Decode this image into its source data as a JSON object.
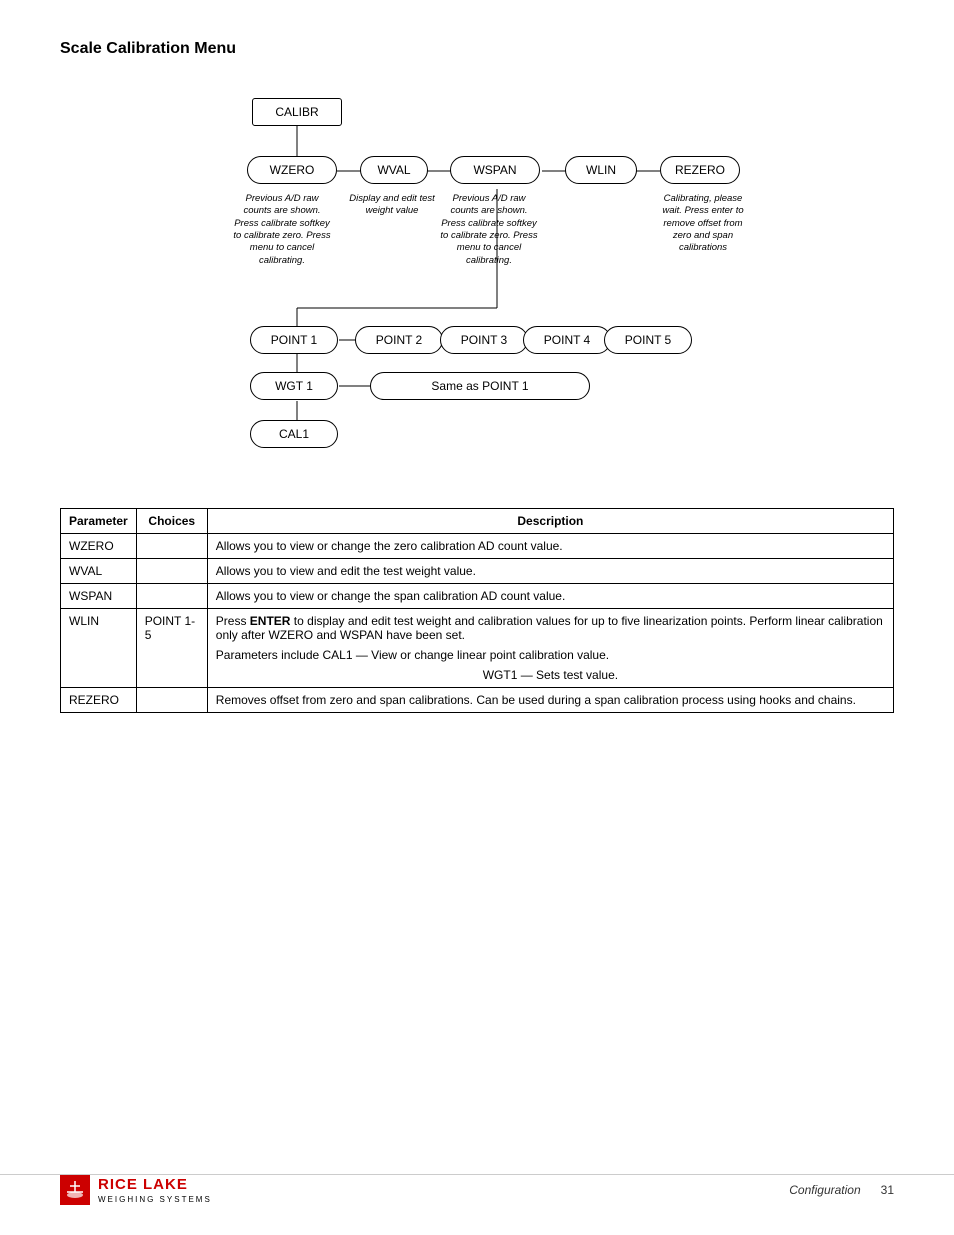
{
  "page": {
    "title": "Scale Calibration Menu"
  },
  "diagram": {
    "nodes": {
      "calibr": "CALIBR",
      "wzero": "WZERO",
      "wval": "WVAL",
      "wspan": "WSPAN",
      "wlin": "WLIN",
      "rezero": "REZERO",
      "point1": "POINT 1",
      "point2": "POINT 2",
      "point3": "POINT 3",
      "point4": "POINT 4",
      "point5": "POINT 5",
      "wgt1": "WGT 1",
      "same_as": "Same as POINT 1",
      "cal1": "CAL1"
    },
    "descriptions": {
      "wzero": "Previous A/D raw counts are shown. Press calibrate softkey to calibrate zero. Press menu to cancel calibrating.",
      "wval": "Display and edit test weight value",
      "wspan": "Previous A/D raw counts are shown. Press calibrate softkey to calibrate zero. Press menu to cancel calibrating.",
      "rezero": "Calibrating, please wait. Press enter to remove offset from zero and span calibrations"
    }
  },
  "table": {
    "headers": [
      "Parameter",
      "Choices",
      "Description"
    ],
    "rows": [
      {
        "parameter": "WZERO",
        "choices": "",
        "description": "Allows you to view or change the zero calibration AD count value."
      },
      {
        "parameter": "WVAL",
        "choices": "",
        "description": "Allows you to view and edit the test weight value."
      },
      {
        "parameter": "WSPAN",
        "choices": "",
        "description": "Allows you to view or change the span calibration AD count value."
      },
      {
        "parameter": "WLIN",
        "choices": "POINT 1-5",
        "description_parts": [
          "Press ENTER to display and edit test weight and calibration values for up to five linearization points. Perform linear calibration only after WZERO and WSPAN have been set.",
          "Parameters include CAL1 — View or change linear point calibration value.",
          "WGT1 — Sets test value."
        ]
      },
      {
        "parameter": "REZERO",
        "choices": "",
        "description": "Removes offset from zero and span calibrations. Can be used during a span calibration process using hooks and chains."
      }
    ]
  },
  "footer": {
    "brand": "RICE LAKE",
    "subtitle": "WEIGHING SYSTEMS",
    "section": "Configuration",
    "page": "31"
  }
}
